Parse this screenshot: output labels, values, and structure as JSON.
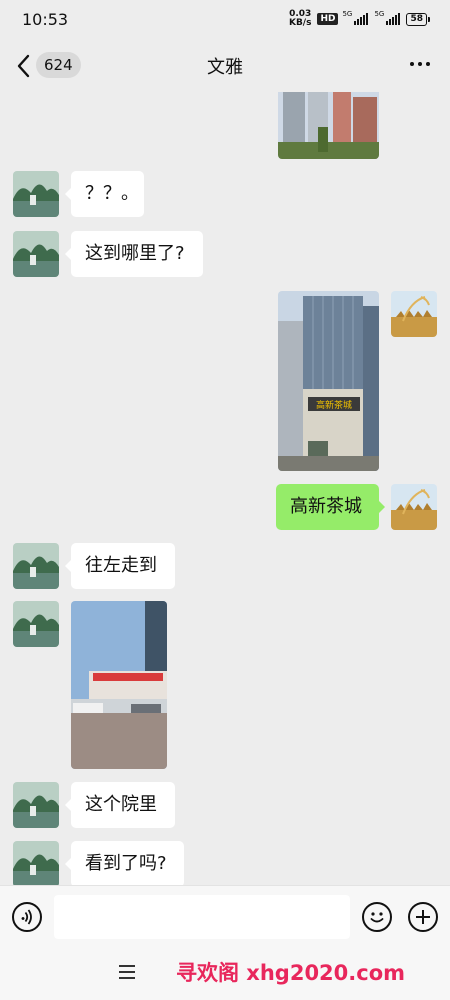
{
  "status_bar": {
    "time": "10:53",
    "net_speed_value": "0.03",
    "net_speed_unit": "KB/s",
    "hd_label": "HD",
    "signal1_label": "5G",
    "signal2_label": "5G",
    "battery": "58"
  },
  "header": {
    "unread_count": "624",
    "title": "文雅"
  },
  "messages": {
    "m1": "？？。",
    "m2": "这到哪里了?",
    "m3": "高新茶城",
    "m4": "往左走到",
    "m5": "这个院里",
    "m6": "看到了吗?"
  },
  "photos": {
    "p2_sign": "高新茶城"
  },
  "watermark": "寻欢阁 xhg2020.com",
  "icons": [
    "back-arrow-icon",
    "more-icon",
    "voice-icon",
    "emoji-icon",
    "plus-icon",
    "menu-icon"
  ]
}
